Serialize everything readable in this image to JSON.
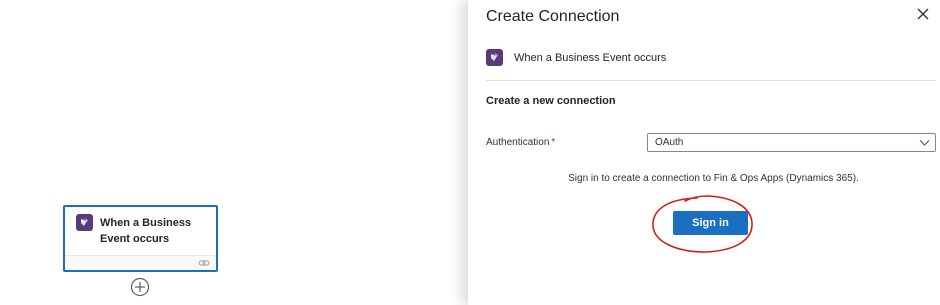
{
  "canvas": {
    "trigger_card": {
      "title": "When a Business Event occurs",
      "icon": "dynamics-365-icon",
      "footer_icon": "link-icon"
    },
    "add_step_icon": "plus-circle-icon"
  },
  "panel": {
    "title": "Create Connection",
    "close_icon": "close-icon",
    "connector": {
      "name": "When a Business Event occurs",
      "icon": "dynamics-365-icon"
    },
    "section_heading": "Create a new connection",
    "authentication": {
      "label": "Authentication",
      "required_mark": "*",
      "selected_value": "OAuth",
      "dropdown_icon": "chevron-down-icon"
    },
    "info_text": "Sign in to create a connection to Fin & Ops Apps (Dynamics 365).",
    "sign_in_label": "Sign in"
  },
  "colors": {
    "accent": "#1a6fc0",
    "connector_brand": "#5b3a7a",
    "annotation_red": "#d81b1b",
    "required_red": "#a4262c"
  }
}
